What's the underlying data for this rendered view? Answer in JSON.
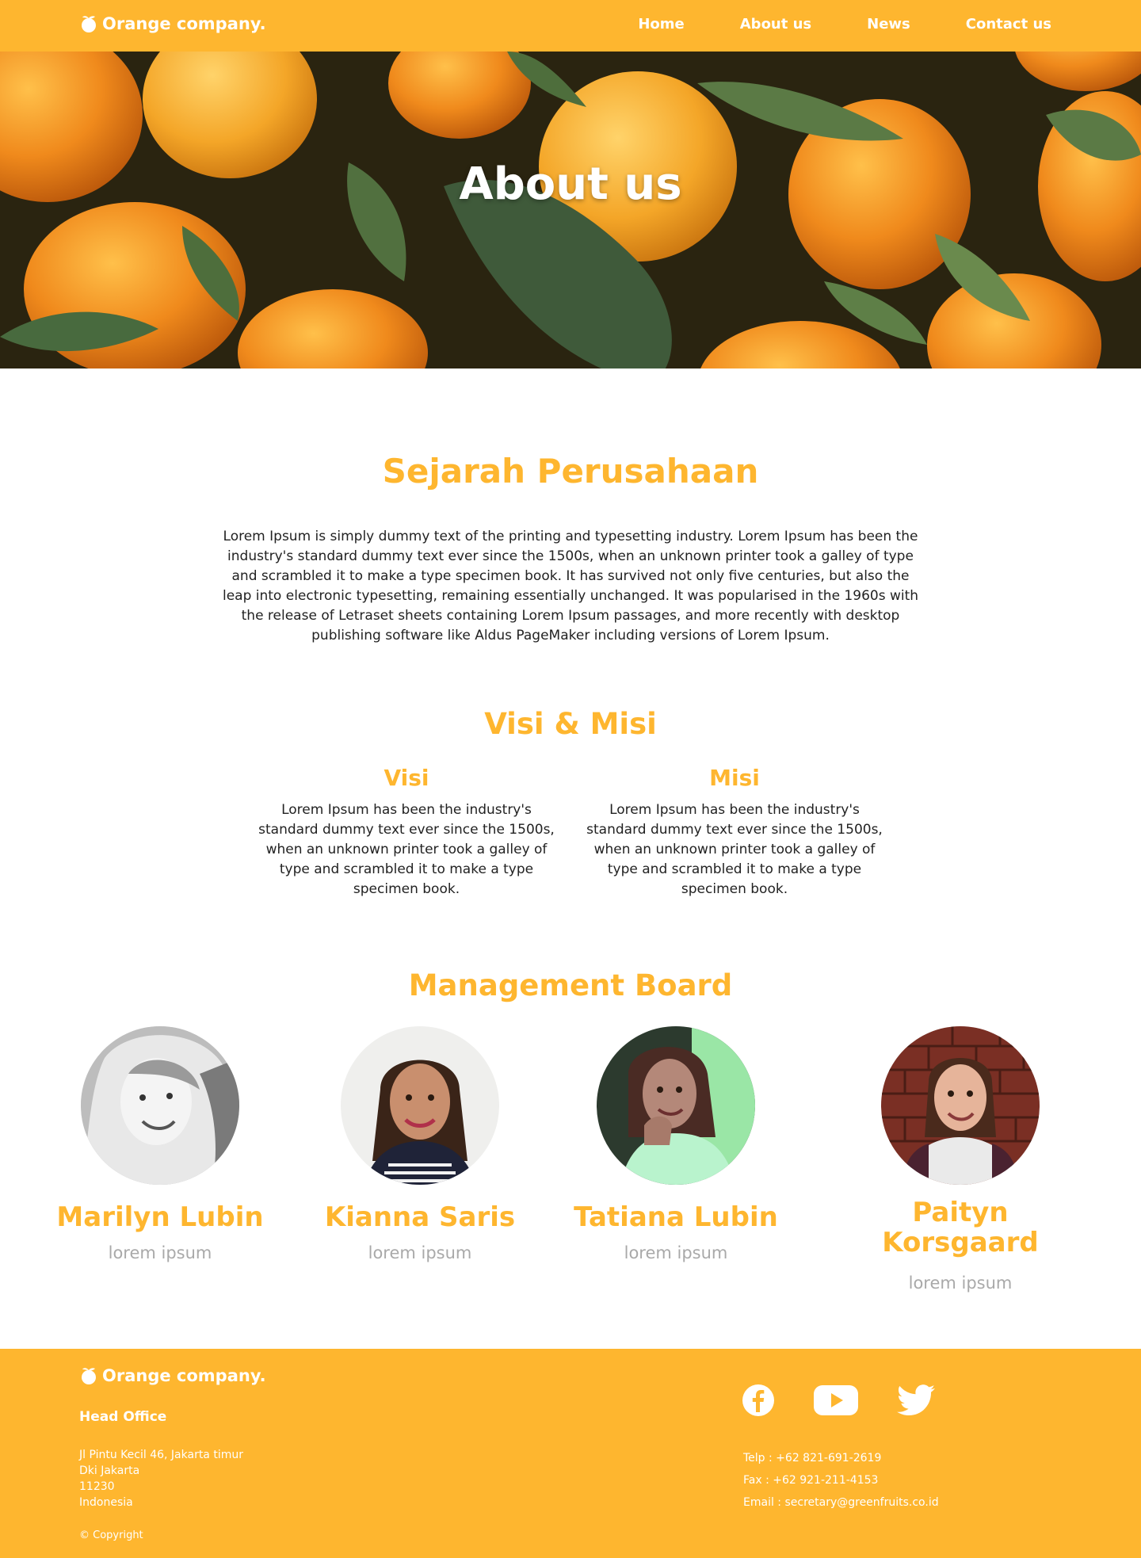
{
  "brand": {
    "name": "Orange company."
  },
  "nav": {
    "items": [
      "Home",
      "About us",
      "News",
      "Contact us"
    ]
  },
  "hero": {
    "title": "About us"
  },
  "history": {
    "title": "Sejarah Perusahaan",
    "text": "Lorem Ipsum is simply dummy text of the printing and typesetting industry. Lorem Ipsum has been the industry's standard dummy text ever since the 1500s, when an unknown printer took a galley of type and scrambled it to make a type specimen book. It has survived not only five centuries, but also the leap into electronic typesetting, remaining essentially unchanged. It was popularised in the 1960s with the release of Letraset sheets containing Lorem Ipsum passages, and more recently with desktop publishing software like Aldus PageMaker including versions of Lorem Ipsum."
  },
  "vision_mission": {
    "title": "Visi & Misi",
    "visi": {
      "title": "Visi",
      "text": "Lorem Ipsum has been the industry's standard dummy text ever since the 1500s, when an unknown printer took a galley of type and scrambled it to make a type specimen book."
    },
    "misi": {
      "title": "Misi",
      "text": "Lorem Ipsum has been the industry's standard dummy text ever since the 1500s, when an unknown printer took a galley of type and scrambled it to make a type specimen book."
    }
  },
  "board": {
    "title": "Management Board",
    "members": [
      {
        "name": "Marilyn Lubin",
        "role": "lorem ipsum"
      },
      {
        "name": "Kianna Saris",
        "role": "lorem ipsum"
      },
      {
        "name": "Tatiana Lubin",
        "role": "lorem ipsum"
      },
      {
        "name": "Paityn Korsgaard",
        "role": "lorem ipsum"
      }
    ]
  },
  "footer": {
    "brand": "Orange company.",
    "head_office_label": "Head Office",
    "address_lines": [
      "Jl Pintu Kecil 46, Jakarta timur",
      "Dki Jakarta",
      "11230",
      "Indonesia"
    ],
    "copyright": "© Copyright",
    "social_icons": [
      "facebook-icon",
      "youtube-icon",
      "twitter-icon"
    ],
    "telp": "Telp : +62 821-691-2619",
    "fax": "Fax : +62 921-211-4153",
    "email": "Email : secretary@greenfruits.co.id"
  },
  "colors": {
    "accent": "#FEB62F",
    "text": "#222222",
    "muted": "#a9a9a9",
    "white": "#ffffff"
  }
}
